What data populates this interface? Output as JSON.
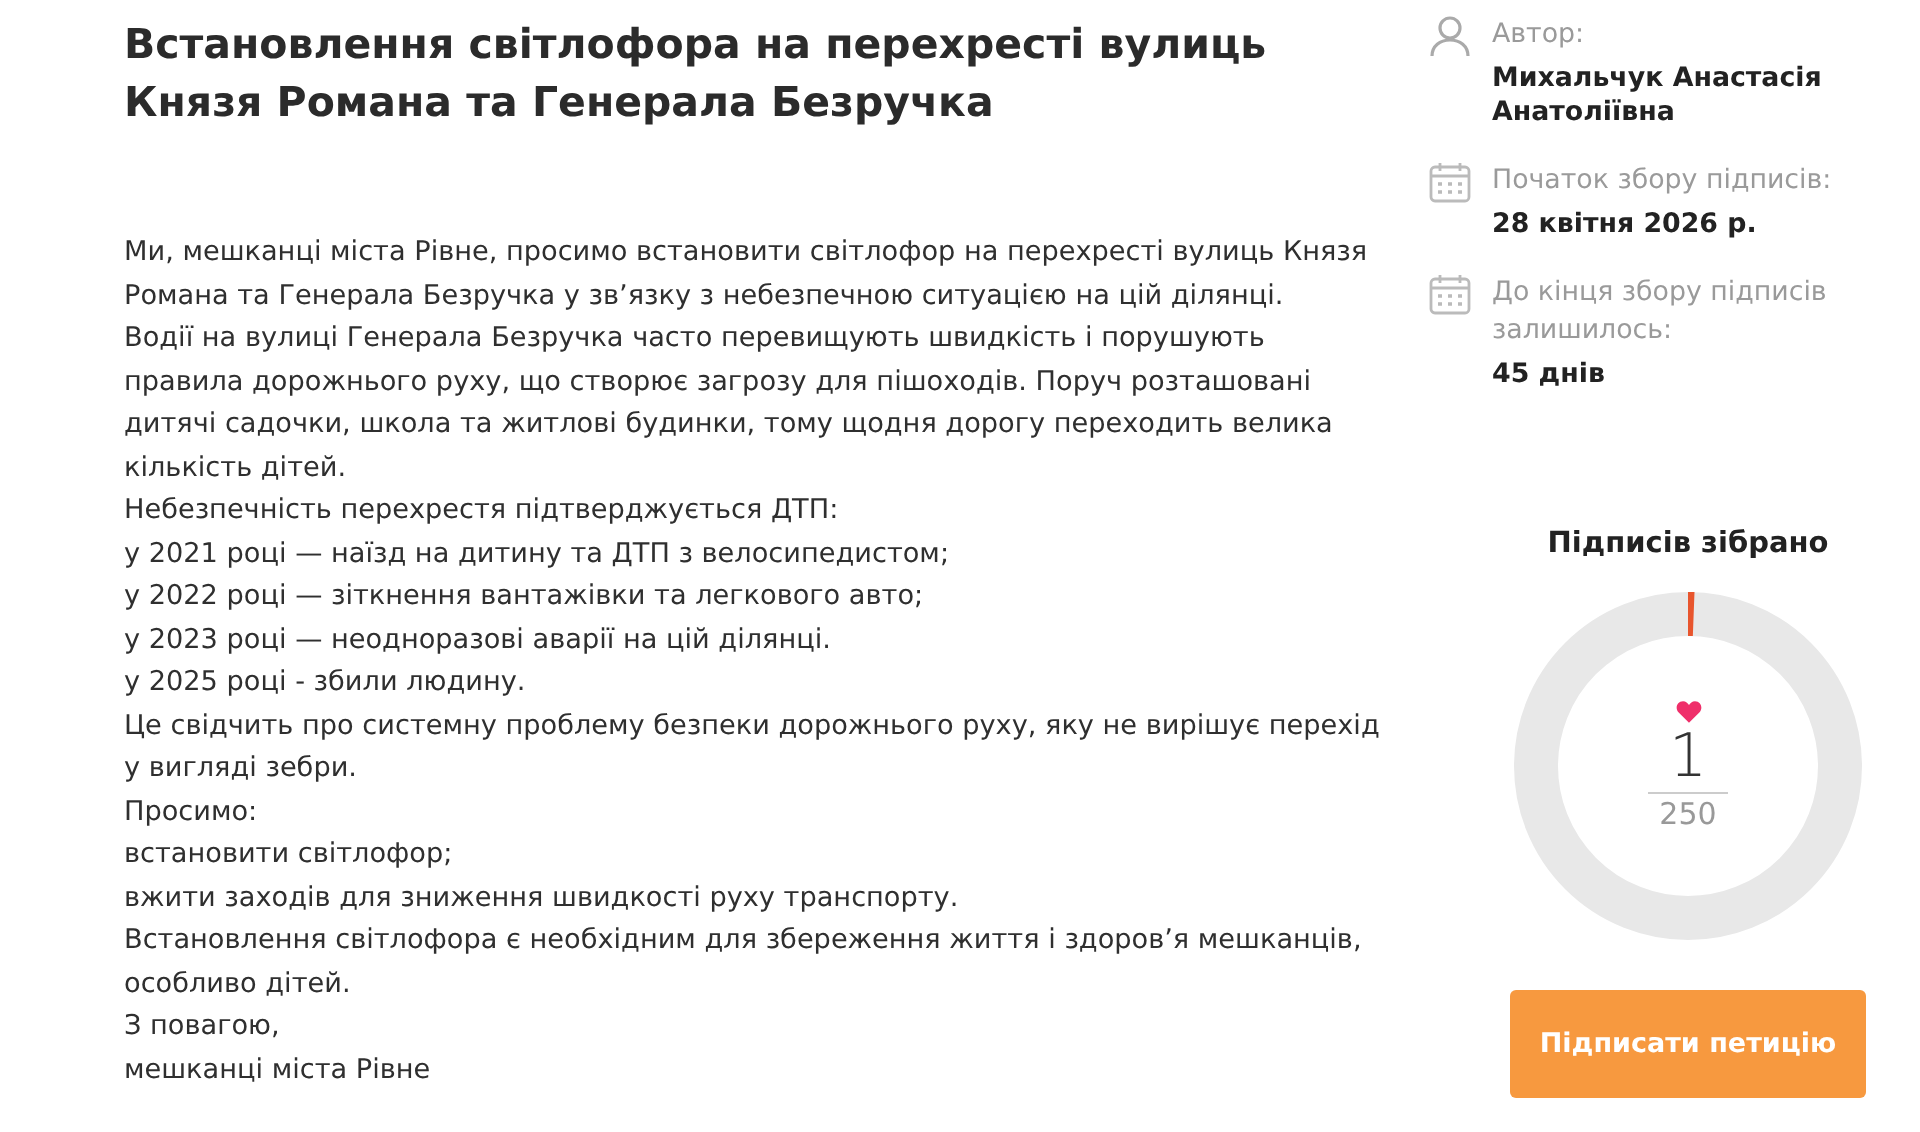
{
  "title": "Встановлення світлофора на перехресті вулиць Князя Романа та Генерала Безручка",
  "body": [
    "Ми, мешканці міста Рівне, просимо встановити світлофор на перехресті вулиць Князя Романа та Генерала Безручка у зв’язку з небезпечною ситуацією на цій ділянці.",
    "Водії на вулиці Генерала Безручка часто перевищують швидкість і порушують правила дорожнього руху, що створює загрозу для пішоходів. Поруч розташовані дитячі садочки, школа та житлові будинки, тому щодня дорогу переходить велика кількість дітей.",
    "Небезпечність перехрестя підтверджується ДТП:",
    "у 2021 році — наїзд на дитину та ДТП з велосипедистом;",
    "у 2022 році — зіткнення вантажівки та легкового авто;",
    "у 2023 році — неодноразові аварії на цій ділянці.",
    "у 2025 році - збили людину.",
    "Це свідчить про системну проблему безпеки дорожнього руху, яку не вирішує перехід у вигляді зебри.",
    "Просимо:",
    "встановити світлофор;",
    "вжити заходів для зниження швидкості руху транспорту.",
    "Встановлення світлофора є необхідним для збереження життя і здоров’я мешканців, особливо дітей.",
    "З повагою,",
    "мешканці міста Рівне"
  ],
  "info": [
    {
      "kind": "person",
      "label": "Автор:",
      "value": "Михальчук Анастасія Анатоліївна"
    },
    {
      "kind": "calendar",
      "label": "Початок збору підписів:",
      "value": "28 квітня 2026 р."
    },
    {
      "kind": "calendar",
      "label": "До кінця збору підписів залишилось:",
      "value": "45 днів"
    }
  ],
  "signatures": {
    "title": "Підписів зібрано",
    "count": "1",
    "goal": "250",
    "level": 0.004
  },
  "sign_button": "Підписати петицію"
}
